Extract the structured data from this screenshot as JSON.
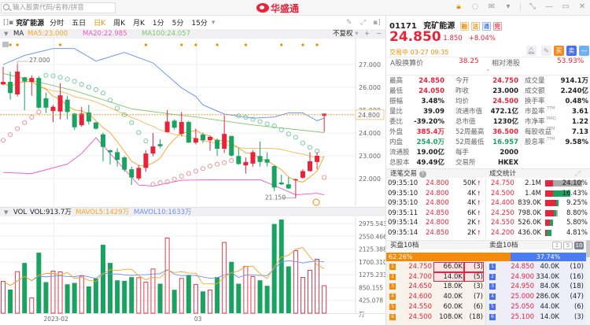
{
  "search": {
    "placeholder": "输入股票代码/名称/拼音"
  },
  "logo": {
    "text": "华盛通"
  },
  "toolbar": {
    "stock_name": "兖矿能源",
    "tabs": [
      "分时",
      "五日",
      "日K",
      "周K",
      "月K",
      "1分",
      "5分",
      "15分"
    ],
    "active_tab": "日K",
    "more": "▾"
  },
  "ma_row": {
    "label": "MA",
    "ma5": "MA5:23.000",
    "ma20": "MA20:22.985",
    "ma100": "MA100:24.057",
    "adjust": "不复权",
    "ma5_color": "#f5a623",
    "ma20_color": "#f055c8",
    "ma100_color": "#7cc86a"
  },
  "vol_row": {
    "label": "VOL",
    "vol": "VOL:913.7万",
    "mavol5": "MAVOL5:1429万",
    "mavol10": "MAVOL10:1633万"
  },
  "quote": {
    "code": "01171",
    "name": "兖矿能源",
    "badges": [
      "融",
      "沽",
      "通",
      "完"
    ],
    "price": "24.850",
    "change": "1.850",
    "change_pct": "+8.04%",
    "status": "交易中 03-27 09:35",
    "buy_label": "买",
    "sell_label": "卖",
    "minus_label": "—",
    "a_share_label": "A股换算价",
    "a_share_value": "38.25",
    "relative_label": "相对港股",
    "relative_value": "53.93%"
  },
  "stats": [
    [
      {
        "l": "最高",
        "v": "24.850",
        "c": "r"
      },
      {
        "l": "今开",
        "v": "24.750",
        "c": "r"
      },
      {
        "l": "成交量",
        "v": "914.1万",
        "c": ""
      }
    ],
    [
      {
        "l": "最低",
        "v": "24.050",
        "c": "r"
      },
      {
        "l": "昨收",
        "v": "23.000",
        "c": ""
      },
      {
        "l": "成交额",
        "v": "2.240亿",
        "c": ""
      }
    ],
    [
      {
        "l": "振幅",
        "v": "3.48%",
        "c": ""
      },
      {
        "l": "均价",
        "v": "24.500",
        "c": "r"
      },
      {
        "l": "换手率",
        "v": "0.48%",
        "c": ""
      }
    ],
    [
      {
        "l": "量比",
        "v": "39.09",
        "c": ""
      },
      {
        "l": "流通市值",
        "v": "472.1亿",
        "c": ""
      },
      {
        "l": "市盈率",
        "s": "TTM",
        "v": "3.61",
        "c": ""
      }
    ],
    [
      {
        "l": "委比",
        "v": "-39.20%",
        "c": ""
      },
      {
        "l": "总市值",
        "v": "1230亿",
        "c": ""
      },
      {
        "l": "市净率",
        "s": "MRQ",
        "v": "1.22",
        "c": ""
      }
    ],
    [
      {
        "l": "外盘",
        "v": "385.4万",
        "c": "r"
      },
      {
        "l": "52周最高",
        "v": "36.500",
        "c": "r"
      },
      {
        "l": "每股收益",
        "s": "TTM",
        "v": "7.13",
        "c": ""
      }
    ],
    [
      {
        "l": "内盘",
        "v": "254.0万",
        "c": "g"
      },
      {
        "l": "52周最低",
        "v": "16.957",
        "c": "g"
      },
      {
        "l": "股息率",
        "s": "TTM",
        "v": "9.58%",
        "c": ""
      }
    ],
    [
      {
        "l": "流通股",
        "v": "19.00亿",
        "c": ""
      },
      {
        "l": "每手",
        "v": "2000",
        "c": ""
      }
    ],
    [
      {
        "l": "总股本",
        "v": "49.49亿",
        "c": ""
      },
      {
        "l": "交易所",
        "v": "HKEX",
        "c": ""
      }
    ]
  ],
  "trades": {
    "title": "逐笔交易",
    "help": "?",
    "rows": [
      {
        "t": "09:35:10",
        "p": "24.800",
        "q": "50K"
      },
      {
        "t": "09:35:10",
        "p": "24.800",
        "q": "4K"
      },
      {
        "t": "09:35:10",
        "p": "24.800",
        "q": "4K"
      },
      {
        "t": "09:35:11",
        "p": "24.850",
        "q": "6K"
      },
      {
        "t": "09:35:14",
        "p": "24.800",
        "q": "2K"
      },
      {
        "t": "09:35:14",
        "p": "24.850",
        "q": "2K"
      }
    ]
  },
  "deal_stats": {
    "title": "成交统计",
    "rows": [
      {
        "p": "24.750",
        "v": "2.1M",
        "pct": "24.10%",
        "red": 0.21,
        "green": 0,
        "grey": 0.79
      },
      {
        "p": "24.500",
        "v": "1.4M",
        "pct": "16.43%",
        "red": 0.21,
        "green": 0.47,
        "grey": 0
      },
      {
        "p": "24.400",
        "v": "839.0K",
        "pct": "9.25%",
        "red": 0.29,
        "green": 0.07,
        "grey": 0
      },
      {
        "p": "24.250",
        "v": "798.0K",
        "pct": "8.80%",
        "red": 0.23,
        "green": 0.06,
        "grey": 0.04
      },
      {
        "p": "24.550",
        "v": "526.0K",
        "pct": "5.80%",
        "red": 0.12,
        "green": 0.09,
        "grey": 0
      },
      {
        "p": "24.200",
        "v": "436.0K",
        "pct": "4.81%",
        "red": 0.04,
        "green": 0.14,
        "grey": 0
      }
    ]
  },
  "orderbook": {
    "buy_title": "买盘10档",
    "sell_title": "卖盘10档",
    "depth_options": [
      "1",
      "5",
      "10"
    ],
    "buy_pct": "62.26%",
    "sell_pct": "37.74%",
    "buy_ratio": 0.6226,
    "buy": [
      {
        "n": "1",
        "p": "24.750",
        "q": "66.0K",
        "c": "(3)",
        "hl": true
      },
      {
        "n": "2",
        "p": "24.700",
        "q": "14.0K",
        "c": "(5)",
        "hl": true
      },
      {
        "n": "3",
        "p": "24.650",
        "q": "18.0K",
        "c": "(3)"
      },
      {
        "n": "4",
        "p": "24.600",
        "q": "40.0K",
        "c": "(7)"
      },
      {
        "n": "5",
        "p": "24.550",
        "q": "60.0K",
        "c": "(6)"
      },
      {
        "n": "6",
        "p": "24.500",
        "q": "108.0K",
        "c": "(18)"
      }
    ],
    "sell": [
      {
        "n": "1",
        "p": "24.850",
        "q": "40.0K",
        "c": "(10)"
      },
      {
        "n": "2",
        "p": "24.900",
        "q": "334.0K",
        "c": "(16)"
      },
      {
        "n": "3",
        "p": "24.950",
        "q": "84.0K",
        "c": "(18)"
      },
      {
        "n": "4",
        "p": "25.000",
        "q": "286.0K",
        "c": "(47)"
      },
      {
        "n": "5",
        "p": "25.050",
        "q": "44.0K",
        "c": "(6)"
      },
      {
        "n": "6",
        "p": "25.100",
        "q": "14.0K",
        "c": "(3)"
      }
    ]
  },
  "colors": {
    "up": "#e8243a",
    "down": "#1aa260",
    "accent": "#f08c00",
    "sell": "#4a7cf7"
  },
  "chart_data": {
    "type": "candlestick",
    "ohlc": [
      [
        26.13,
        26.9,
        26.09,
        26.24
      ],
      [
        26.24,
        26.69,
        25.46,
        25.75
      ],
      [
        25.69,
        27.0,
        25.6,
        26.69
      ],
      [
        26.44,
        26.46,
        25.0,
        26.26
      ],
      [
        26.23,
        26.53,
        25.63,
        26.41
      ],
      [
        26.41,
        26.49,
        25.06,
        25.11
      ],
      [
        25.52,
        25.77,
        24.88,
        25.11
      ],
      [
        24.96,
        25.23,
        24.48,
        25.15
      ],
      [
        24.94,
        26.18,
        24.6,
        25.65
      ],
      [
        25.46,
        25.63,
        24.6,
        24.92
      ],
      [
        24.85,
        24.88,
        24.14,
        24.25
      ],
      [
        24.34,
        25.15,
        24.27,
        24.85
      ],
      [
        24.9,
        25.23,
        24.37,
        24.5
      ],
      [
        24.46,
        24.48,
        24.14,
        24.19
      ],
      [
        23.94,
        24.02,
        22.76,
        23.39
      ],
      [
        23.24,
        23.27,
        22.62,
        23.16
      ],
      [
        23.16,
        23.33,
        22.53,
        22.82
      ],
      [
        22.93,
        22.99,
        22.3,
        22.39
      ],
      [
        22.41,
        22.53,
        21.72,
        22.05
      ],
      [
        22.01,
        22.59,
        21.93,
        22.47
      ],
      [
        22.47,
        23.24,
        22.3,
        23.1
      ],
      [
        23.1,
        24.0,
        22.99,
        23.41
      ],
      [
        23.51,
        23.73,
        23.33,
        23.42
      ],
      [
        24.04,
        25.0,
        24.02,
        24.5
      ],
      [
        24.54,
        24.6,
        24.14,
        24.23
      ],
      [
        23.96,
        24.92,
        23.85,
        24.48
      ],
      [
        24.48,
        24.54,
        23.56,
        23.58
      ],
      [
        23.58,
        24.19,
        23.5,
        23.77
      ],
      [
        23.93,
        24.02,
        23.56,
        23.68
      ],
      [
        23.68,
        23.88,
        23.22,
        23.83
      ],
      [
        23.7,
        23.77,
        22.99,
        23.31
      ],
      [
        23.31,
        24.77,
        23.13,
        23.96
      ],
      [
        23.87,
        23.87,
        22.96,
        23.01
      ],
      [
        22.99,
        23.33,
        22.61,
        22.64
      ],
      [
        22.58,
        22.93,
        22.22,
        22.73
      ],
      [
        22.66,
        23.24,
        22.53,
        23.16
      ],
      [
        22.99,
        23.62,
        22.53,
        22.73
      ],
      [
        22.85,
        23.16,
        22.53,
        22.7
      ],
      [
        22.55,
        22.59,
        21.45,
        21.61
      ],
      [
        21.83,
        22.18,
        21.72,
        21.75
      ],
      [
        21.75,
        22.07,
        21.55,
        21.57
      ],
      [
        21.93,
        22.0,
        21.15,
        21.97
      ],
      [
        22.04,
        22.41,
        22.0,
        22.33
      ],
      [
        22.33,
        23.16,
        22.3,
        22.76
      ],
      [
        22.73,
        23.16,
        22.41,
        23.0
      ],
      [
        24.75,
        24.85,
        24.05,
        24.85
      ]
    ],
    "volume": [
      1056,
      785,
      1379,
      1667,
      506,
      2007,
      1030,
      1396,
      1370,
      960,
      1004,
      1230,
      890,
      1152,
      2269,
      1667,
      1091,
      1073,
      1196,
      1178,
      1030,
      1466,
      977,
      2496,
      777,
      1152,
      1265,
      951,
      724,
      768,
      1196,
      2348,
      1702,
      977,
      1553,
      1213,
      1091,
      908,
      2958,
      3107,
      1553,
      2077,
      1187,
      1422,
      1789,
      913.7
    ],
    "upper_band": [
      [
        0,
        27.0
      ],
      [
        3,
        27.4
      ],
      [
        7,
        27.7
      ],
      [
        10,
        27.7
      ],
      [
        13,
        27.15
      ],
      [
        17,
        27.53
      ],
      [
        21,
        27.07
      ],
      [
        25,
        25.98
      ],
      [
        27,
        25.6
      ],
      [
        28,
        25.23
      ],
      [
        31,
        24.83
      ],
      [
        35,
        24.65
      ],
      [
        38,
        24.7
      ],
      [
        40,
        24.88
      ],
      [
        42,
        24.88
      ],
      [
        44,
        24.54
      ],
      [
        45,
        24.65
      ]
    ],
    "lower_band": [
      [
        0,
        22.27
      ],
      [
        4,
        22.22
      ],
      [
        9,
        22.64
      ],
      [
        11,
        23.1
      ],
      [
        13,
        23.79
      ],
      [
        15,
        23.1
      ],
      [
        19,
        21.72
      ],
      [
        21,
        21.67
      ],
      [
        25,
        21.93
      ],
      [
        30,
        21.95
      ],
      [
        36,
        21.95
      ],
      [
        38,
        21.7
      ],
      [
        41,
        21.29
      ],
      [
        44,
        21.36
      ],
      [
        45,
        21.29
      ]
    ],
    "ma100": [
      [
        0,
        26.61
      ],
      [
        10,
        25.85
      ],
      [
        18,
        25.06
      ],
      [
        25,
        24.77
      ],
      [
        27,
        24.7
      ],
      [
        35,
        24.35
      ],
      [
        45,
        24.02
      ]
    ],
    "sar": [
      23.68,
      23.93,
      24.19,
      24.46,
      24.69,
      24.92,
      26.53,
      26.5,
      26.44,
      26.36,
      26.26,
      26.13,
      26.01,
      25.9,
      25.75,
      25.44,
      25.09,
      24.8,
      24.46,
      24.02,
      23.65,
      21.75,
      21.82,
      21.86,
      21.98,
      22.11,
      22.22,
      22.33,
      22.44,
      22.55,
      22.63,
      22.7,
      22.79,
      24.75,
      24.69,
      24.6,
      24.5,
      24.4,
      24.31,
      24.14,
      23.96,
      23.81,
      23.56,
      23.37,
      23.21,
      22.05
    ],
    "event_markers": [
      1,
      2,
      8,
      20,
      25,
      27,
      30,
      34,
      39,
      42,
      44
    ],
    "price_ticks": [
      "27.000",
      "26.000",
      "25.000",
      "24.000",
      "23.000",
      "22.000"
    ],
    "price_range": [
      21.0,
      28.15
    ],
    "current_price_label": "24.800",
    "high_label": {
      "text": "27.000",
      "index": 2
    },
    "low_label": {
      "text": "21.150",
      "index": 41
    },
    "volume_ticks": [
      "2975.543",
      "2550.466",
      "2125.388",
      "1700.310",
      "1275.233",
      "850.155",
      "425.078"
    ],
    "volume_unit": "万",
    "x_labels": [
      {
        "label": "2023-02",
        "index": 7
      },
      {
        "label": "03",
        "index": 27
      }
    ]
  }
}
